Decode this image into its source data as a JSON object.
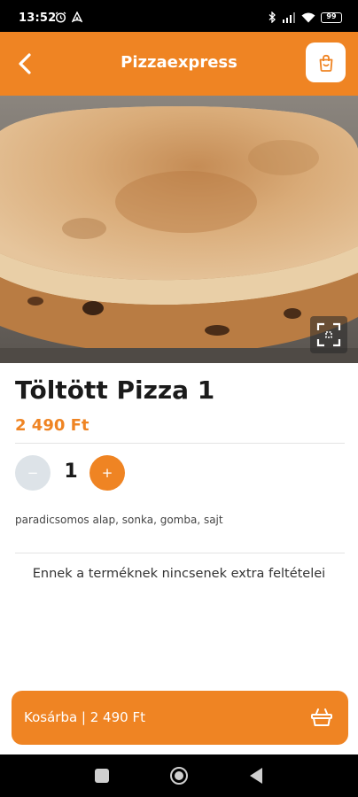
{
  "status_bar": {
    "time": "13:52",
    "battery": "99",
    "icons": [
      "alarm-icon",
      "app-notification-icon",
      "bluetooth-icon",
      "signal-icon",
      "wifi-icon",
      "battery-icon"
    ]
  },
  "app_bar": {
    "title": "Pizzaexpress",
    "back_icon": "chevron-left-icon",
    "cart_icon": "shopping-bag-icon",
    "color": "#ef8423"
  },
  "product": {
    "image_alt": "calzone-photo",
    "name": "Töltött Pizza 1",
    "price": "2 490 Ft",
    "quantity": "1",
    "minus_label": "−",
    "plus_label": "+",
    "ingredients": "paradicsomos alap, sonka, gomba, sajt",
    "extras_note": "Ennek a terméknek nincsenek extra feltételei"
  },
  "cart_button": {
    "label": "Kosárba | 2 490 Ft",
    "icon": "basket-icon"
  },
  "nav_bar": {
    "icons": [
      "recent-apps-icon",
      "home-icon",
      "back-icon"
    ]
  }
}
